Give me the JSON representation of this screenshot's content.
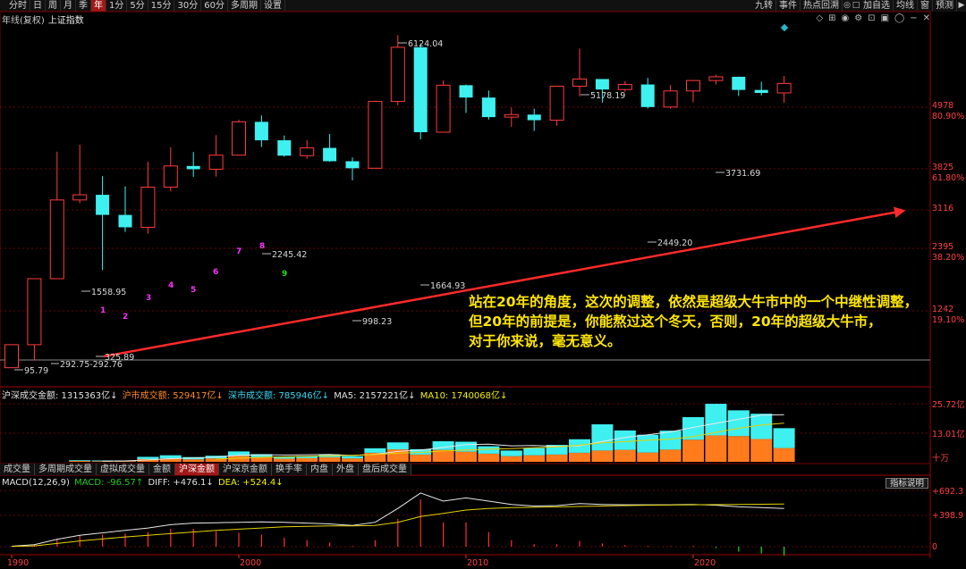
{
  "toolbar": {
    "items": [
      "分时",
      "日",
      "周",
      "月",
      "季",
      "年",
      "1分",
      "5分",
      "15分",
      "30分",
      "60分",
      "多周期",
      "设置"
    ],
    "active": "年",
    "right_items": [
      "九转",
      "事件",
      "热点回溯",
      "加自选",
      "均线",
      "窗",
      "预测"
    ]
  },
  "chart_title": {
    "period": "年线(复权)",
    "name": "上证指数"
  },
  "price_axis": {
    "labels": [
      "4978",
      "3825",
      "3116",
      "2395",
      "1242"
    ],
    "percents": [
      "80.90%",
      "61.80%",
      "38.20%",
      "19.10%"
    ]
  },
  "candles": {
    "annotations": [
      "6124.04",
      "5178.19",
      "3731.69",
      "2449.20",
      "2245.42",
      "1558.95",
      "1664.93",
      "998.23",
      "95.79",
      "292.75-292.76",
      "325.89"
    ],
    "td_counts": [
      "1",
      "2",
      "3",
      "4",
      "5",
      "6",
      "7",
      "8",
      "9"
    ]
  },
  "annotation_text": [
    "站在20年的角度，这次的调整，依然是超级大牛市中的一个中继性调整，",
    "但20年的前提是，你能熬过这个冬天，否则，20年的超级大牛市，",
    "对于你来说，毫无意义。"
  ],
  "volume_info": {
    "total_label": "沪深成交金额: 1315363亿↓",
    "sh_label": "沪市成交额: 529417亿↓",
    "sz_label": "深市成交额: 785946亿↓",
    "ma5_label": "MA5: 2157221亿↓",
    "ma10_label": "MA10: 1740068亿↓"
  },
  "volume_axis": {
    "labels": [
      "25.72亿",
      "13.01亿",
      "十万"
    ]
  },
  "tabs": {
    "items": [
      "成交量",
      "多周期成交量",
      "虚拟成交量",
      "金额",
      "沪深金额",
      "沪深京金额",
      "换手率",
      "内盘",
      "外盘",
      "盘后成交量"
    ],
    "active": "沪深金额"
  },
  "macd_info": {
    "name": "MACD(12,26,9)",
    "macd_label": "MACD: -96.57↑",
    "diff_label": "DIFF: +476.1↓",
    "dea_label": "DEA: +524.4↓"
  },
  "macd_axis": {
    "labels": [
      "+692.3",
      "+398.9",
      "0"
    ]
  },
  "help_button": "指标说明",
  "year_axis": {
    "labels": [
      "1990",
      "2000",
      "2010",
      "2020"
    ]
  },
  "colors": {
    "up": "#ff3b3b",
    "down": "#3ff0f0",
    "sh_volume": "#ff7b1c",
    "sz_volume": "#3ff0f0",
    "macd_dea": "#e6d000",
    "trendline": "#ff2a2a",
    "annotation": "#ffe600"
  },
  "chart_data": {
    "type": "candlestick",
    "x": [
      "1990",
      "1991",
      "1992",
      "1993",
      "1994",
      "1995",
      "1996",
      "1997",
      "1998",
      "1999",
      "2000",
      "2001",
      "2002",
      "2003",
      "2004",
      "2005",
      "2006",
      "2007",
      "2008",
      "2009",
      "2010",
      "2011",
      "2012",
      "2013",
      "2014",
      "2015",
      "2016",
      "2017",
      "2018",
      "2019",
      "2020",
      "2021",
      "2022",
      "2023",
      "2024"
    ],
    "ohlc": [
      [
        96,
        128,
        96,
        128
      ],
      [
        128,
        292,
        105,
        292
      ],
      [
        292,
        1429,
        292,
        781
      ],
      [
        781,
        1558,
        750,
        833
      ],
      [
        833,
        1052,
        325,
        648
      ],
      [
        648,
        926,
        524,
        555
      ],
      [
        555,
        1258,
        512,
        917
      ],
      [
        917,
        1510,
        870,
        1194
      ],
      [
        1194,
        1422,
        1043,
        1147
      ],
      [
        1147,
        1756,
        1047,
        1367
      ],
      [
        1367,
        2125,
        1361,
        2073
      ],
      [
        2073,
        2245,
        1514,
        1646
      ],
      [
        1646,
        1748,
        1339,
        1358
      ],
      [
        1358,
        1649,
        1307,
        1497
      ],
      [
        1497,
        1783,
        1259,
        1267
      ],
      [
        1267,
        1328,
        998,
        1161
      ],
      [
        1161,
        2698,
        1161,
        2675
      ],
      [
        2675,
        6124,
        2541,
        5262
      ],
      [
        5262,
        5522,
        1665,
        1821
      ],
      [
        1821,
        3478,
        1849,
        3277
      ],
      [
        3277,
        3306,
        2319,
        2808
      ],
      [
        2808,
        3067,
        2134,
        2199
      ],
      [
        2199,
        2478,
        1949,
        2269
      ],
      [
        2269,
        2444,
        1849,
        2116
      ],
      [
        2116,
        3239,
        1974,
        3235
      ],
      [
        3235,
        5178,
        2850,
        3539
      ],
      [
        3539,
        3538,
        2638,
        3104
      ],
      [
        3104,
        3450,
        3016,
        3307
      ],
      [
        3307,
        3587,
        2449,
        2494
      ],
      [
        2494,
        3288,
        2440,
        3050
      ],
      [
        3050,
        3474,
        2646,
        3473
      ],
      [
        3473,
        3732,
        3312,
        3640
      ],
      [
        3640,
        3652,
        2864,
        3089
      ],
      [
        3089,
        3419,
        2882,
        2975
      ],
      [
        2975,
        3674,
        2635,
        3352
      ]
    ],
    "trendline_label": "",
    "volume": {
      "series": [
        {
          "name": "沪市成交额",
          "values": [
            0,
            0,
            0,
            0.4,
            0.3,
            0.3,
            1.2,
            1.5,
            1.1,
            1.5,
            2.6,
            2.0,
            1.4,
            1.6,
            2.0,
            1.5,
            4.0,
            5.5,
            3.2,
            5.3,
            4.5,
            3.6,
            2.5,
            2.9,
            3.2,
            4.0,
            5.0,
            5.3,
            4.1,
            5.4,
            9.8,
            11.7,
            11.4,
            10.1,
            6.1
          ]
        },
        {
          "name": "深市成交额",
          "values": [
            0,
            0,
            0,
            0.3,
            0.3,
            0.3,
            1.0,
            1.4,
            1.0,
            1.2,
            2.0,
            1.4,
            0.9,
            1.0,
            1.3,
            1.0,
            2.0,
            3.1,
            2.4,
            3.8,
            4.4,
            3.3,
            2.5,
            3.2,
            4.3,
            6.0,
            11.6,
            8.6,
            7.9,
            8.4,
            10.0,
            14.0,
            11.4,
            11.2,
            8.8
          ]
        }
      ],
      "axis_max": 25.72
    },
    "macd": {
      "series": [
        {
          "name": "DIFF",
          "values": [
            5,
            25,
            90,
            140,
            170,
            200,
            230,
            270,
            290,
            295,
            300,
            305,
            300,
            290,
            280,
            260,
            300,
            470,
            660,
            560,
            600,
            560,
            520,
            500,
            505,
            530,
            520,
            515,
            515,
            515,
            520,
            510,
            490,
            480,
            470
          ]
        },
        {
          "name": "DEA",
          "values": [
            2,
            10,
            40,
            70,
            95,
            120,
            140,
            160,
            180,
            200,
            215,
            230,
            245,
            250,
            255,
            255,
            260,
            300,
            370,
            410,
            450,
            470,
            480,
            485,
            490,
            495,
            500,
            505,
            510,
            512,
            515,
            518,
            520,
            522,
            524
          ]
        }
      ],
      "axis_max": 692.3
    }
  }
}
